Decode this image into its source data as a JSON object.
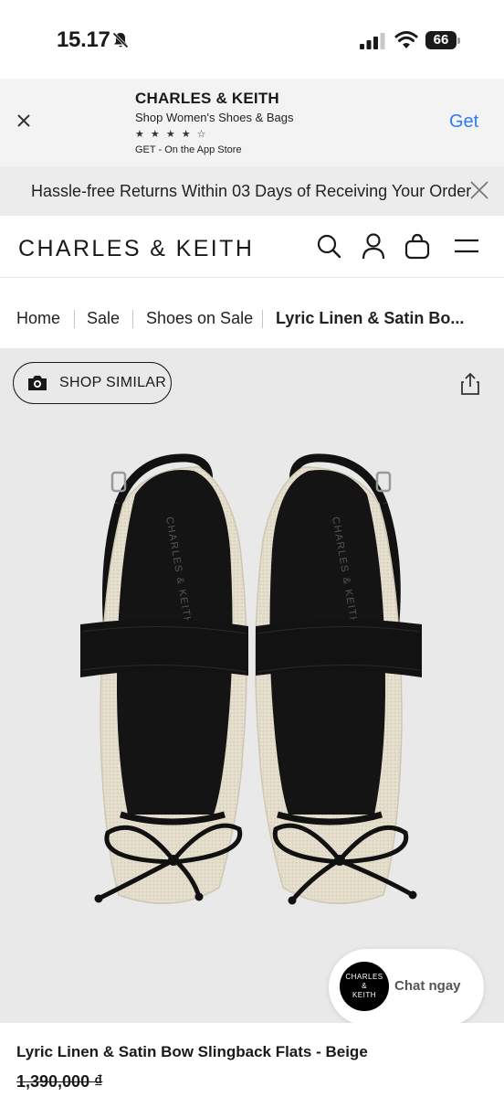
{
  "status_bar": {
    "time": "15.17",
    "battery": "66"
  },
  "app_banner": {
    "title": "CHARLES & KEITH",
    "subtitle": "Shop Women's Shoes & Bags",
    "stars": "★ ★ ★ ★ ☆",
    "cta": "GET - On the App Store",
    "get_label": "Get"
  },
  "promo": {
    "text": "Hassle-free Returns Within 03 Days of Receiving Your Order"
  },
  "header": {
    "logo": "CHARLES & KEITH"
  },
  "breadcrumb": {
    "items": [
      "Home",
      "Sale",
      "Shoes on Sale",
      "Lyric Linen & Satin Bo..."
    ]
  },
  "product": {
    "shop_similar": "SHOP SIMILAR",
    "insole_brand": "CHARLES & KEITH",
    "name": "Lyric Linen & Satin Bow Slingback Flats - Beige",
    "price": "1,390,000 ₫"
  },
  "chat": {
    "avatar_line1": "CHARLES",
    "avatar_line2": "&",
    "avatar_line3": "KEITH",
    "label": "Chat ngay"
  },
  "colors": {
    "accent_link": "#2f7bf5",
    "banner_bg": "#f3f3f4",
    "stage_bg": "#e9e9e9"
  }
}
